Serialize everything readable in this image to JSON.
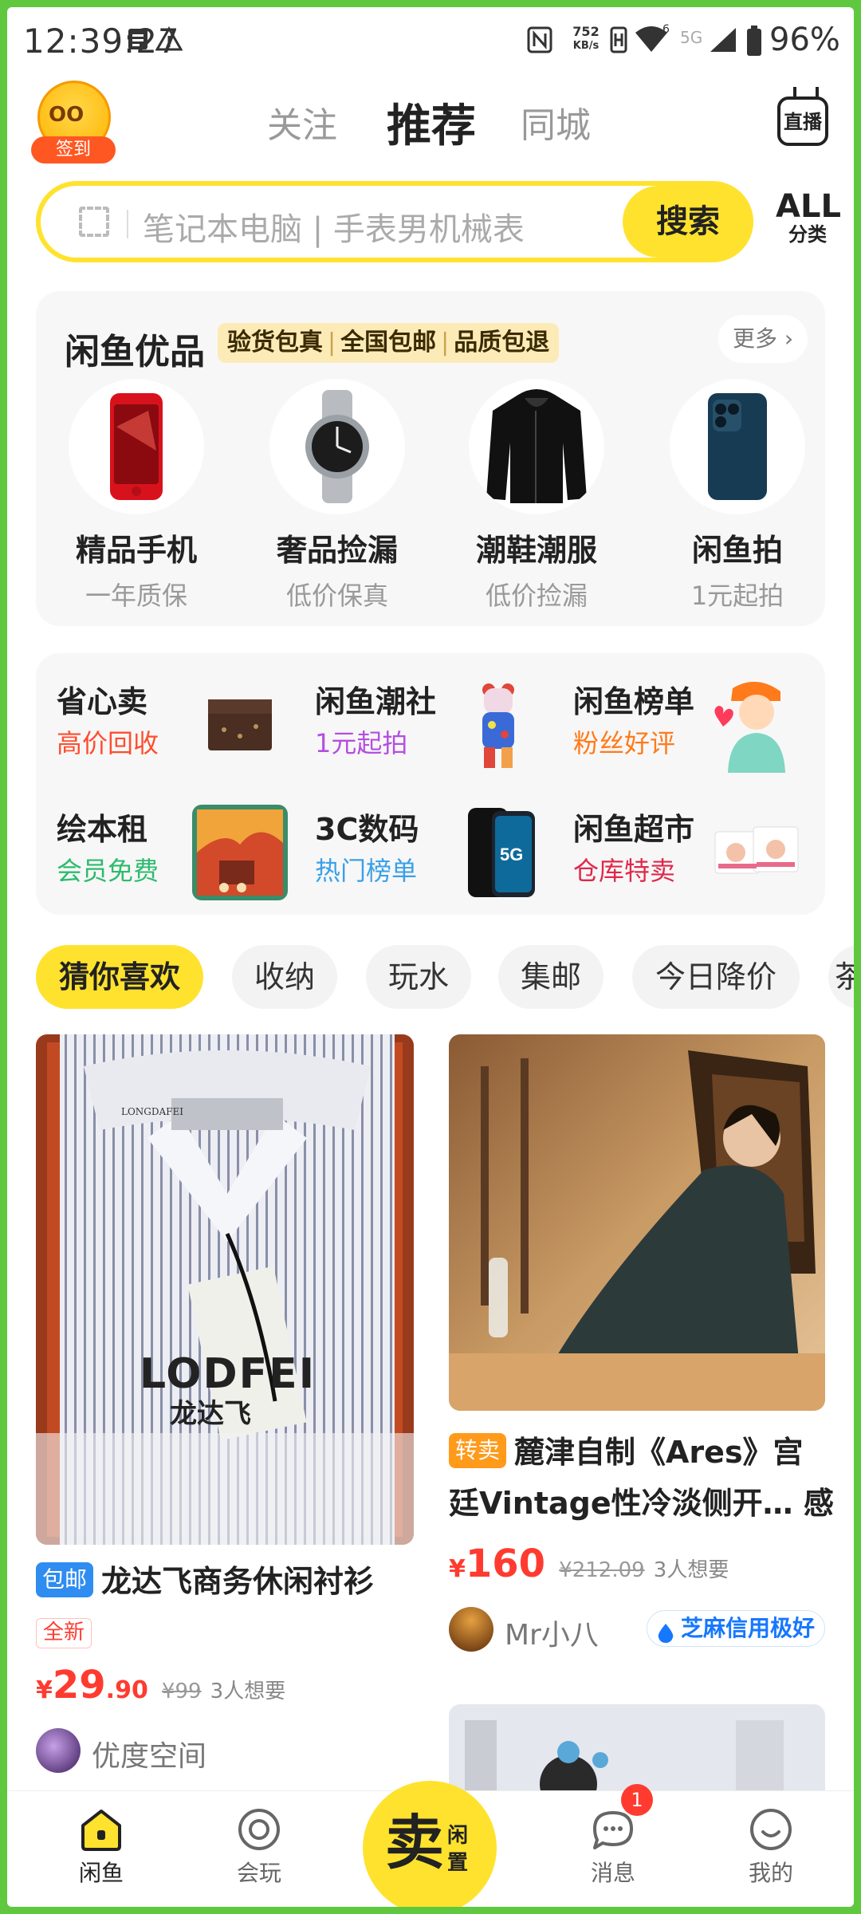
{
  "status_bar": {
    "time": "12:39:27",
    "net_speed": "752",
    "net_unit": "KB/s",
    "wifi_tag": "6",
    "net_type": "5G",
    "battery": "96%"
  },
  "header": {
    "checkin_label": "签到",
    "tabs": [
      {
        "label": "关注",
        "active": false
      },
      {
        "label": "推荐",
        "active": true
      },
      {
        "label": "同城",
        "active": false
      }
    ],
    "live_label": "直播"
  },
  "search": {
    "placeholder": "笔记本电脑 | 手表男机械表",
    "button": "搜索",
    "category_top": "ALL",
    "category_bottom": "分类"
  },
  "youpin": {
    "title": "闲鱼优品",
    "tags": [
      "验货包真",
      "全国包邮",
      "品质包退"
    ],
    "more": "更多",
    "items": [
      {
        "title": "精品手机",
        "subtitle": "一年质保",
        "icon": "red-phone"
      },
      {
        "title": "奢品捡漏",
        "subtitle": "低价保真",
        "icon": "watch"
      },
      {
        "title": "潮鞋潮服",
        "subtitle": "低价捡漏",
        "icon": "hoodie"
      },
      {
        "title": "闲鱼拍",
        "subtitle": "1元起拍",
        "icon": "blue-phone"
      }
    ]
  },
  "grid": [
    {
      "title": "省心卖",
      "subtitle": "高价回收",
      "color": "#ff4d2e",
      "icon": "wallet"
    },
    {
      "title": "闲鱼潮社",
      "subtitle": "1元起拍",
      "color": "#b44fe0",
      "icon": "bear-toy"
    },
    {
      "title": "闲鱼榜单",
      "subtitle": "粉丝好评",
      "color": "#ff7a1a",
      "icon": "cartoon-person"
    },
    {
      "title": "绘本租",
      "subtitle": "会员免费",
      "color": "#2dbb6e",
      "icon": "picture-book"
    },
    {
      "title": "3C数码",
      "subtitle": "热门榜单",
      "color": "#3aa0e8",
      "icon": "phone-5g"
    },
    {
      "title": "闲鱼超市",
      "subtitle": "仓库特卖",
      "color": "#e0284a",
      "icon": "diapers"
    }
  ],
  "chips": [
    {
      "label": "猜你喜欢",
      "active": true
    },
    {
      "label": "收纳",
      "active": false
    },
    {
      "label": "玩水",
      "active": false
    },
    {
      "label": "集邮",
      "active": false
    },
    {
      "label": "今日降价",
      "active": false
    },
    {
      "label": "茶",
      "active": false
    }
  ],
  "feed": {
    "left": {
      "badge": "包邮",
      "title": "龙达飞商务休闲衬衫",
      "condition": "全新",
      "price_symbol": "¥",
      "price_int": "29",
      "price_dec": ".90",
      "old_price": "¥99",
      "wants": "3人想要",
      "seller": "优度空间",
      "brand_big": "LODFEI",
      "brand_cn": "龙达飞",
      "label_small": "LONGDAFEI"
    },
    "right": {
      "badge": "转卖",
      "title_line1": "麓津自制《Ares》宫",
      "title_line2": "廷Vintage性冷淡侧开… 感",
      "price_symbol": "¥",
      "price_int": "160",
      "old_price": "¥212.09",
      "wants": "3人想要",
      "seller": "Mr小八",
      "credit": "芝麻信用极好"
    }
  },
  "bottom_nav": [
    {
      "label": "闲鱼",
      "active": true,
      "icon": "home-icon"
    },
    {
      "label": "会玩",
      "active": false,
      "icon": "circle-icon"
    },
    {
      "label": "消息",
      "active": false,
      "icon": "chat-icon"
    },
    {
      "label": "我的",
      "active": false,
      "icon": "smile-icon"
    }
  ],
  "sell": {
    "big": "卖",
    "small1": "闲",
    "small2": "置"
  },
  "message_count": "1",
  "colors": {
    "accent": "#ffe22e",
    "price": "#ff3b30",
    "frame": "#5fc83f"
  }
}
